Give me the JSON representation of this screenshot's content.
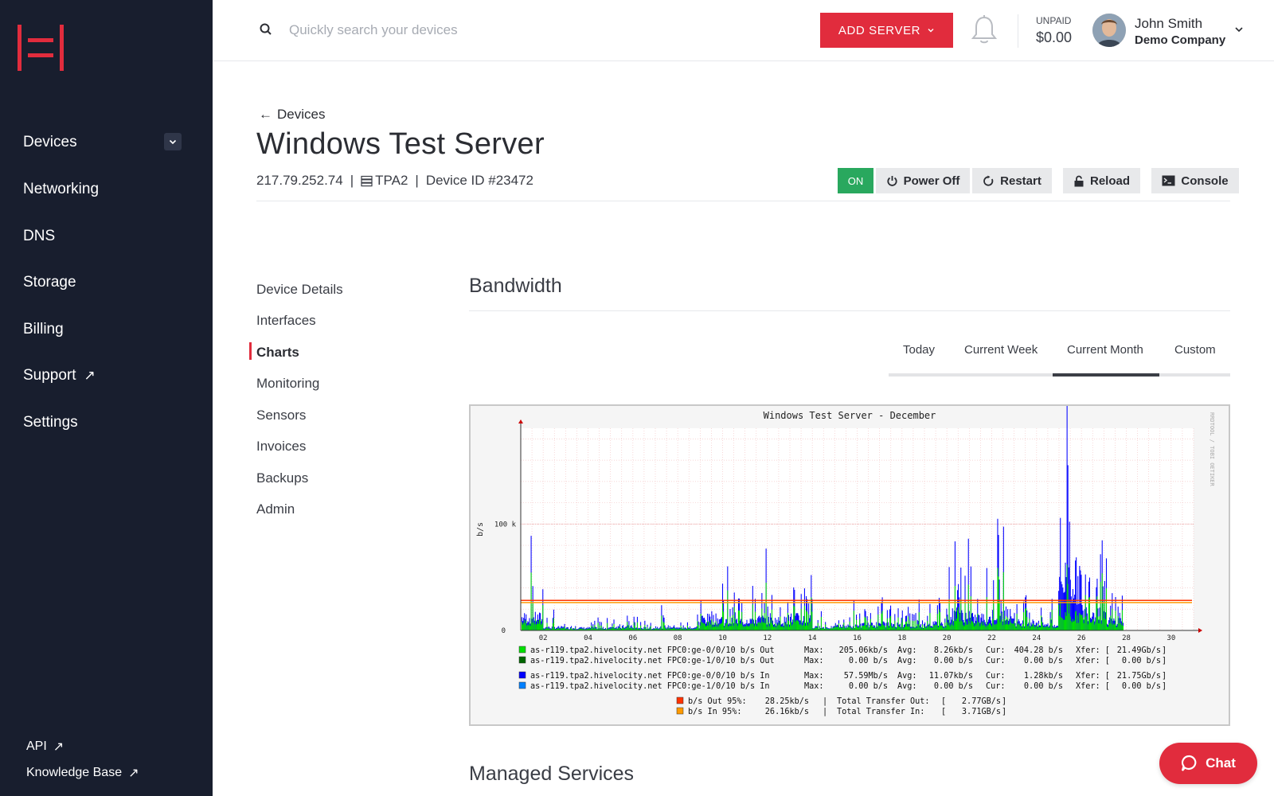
{
  "sidebar": {
    "logo_icon": "hivelocity-logo-icon",
    "items": [
      {
        "label": "Devices",
        "has_chevron": true
      },
      {
        "label": "Networking"
      },
      {
        "label": "DNS"
      },
      {
        "label": "Storage"
      },
      {
        "label": "Billing"
      },
      {
        "label": "Support",
        "external": true
      },
      {
        "label": "Settings"
      }
    ],
    "footer": [
      {
        "label": "API"
      },
      {
        "label": "Knowledge Base"
      }
    ]
  },
  "topbar": {
    "search_placeholder": "Quickly search your devices",
    "add_server_label": "ADD SERVER",
    "unpaid_label": "UNPAID",
    "unpaid_amount": "$0.00",
    "user_name": "John Smith",
    "user_company": "Demo Company"
  },
  "header": {
    "back_label": "Devices",
    "title": "Windows Test Server",
    "ip": "217.79.252.74",
    "location": "TPA2",
    "device_id": "Device ID #23472",
    "power_state": "ON",
    "actions": {
      "power_off": "Power Off",
      "restart": "Restart",
      "reload": "Reload",
      "console": "Console"
    }
  },
  "subnav": {
    "items": [
      "Device Details",
      "Interfaces",
      "Charts",
      "Monitoring",
      "Sensors",
      "Invoices",
      "Backups",
      "Admin"
    ],
    "active": "Charts"
  },
  "bandwidth": {
    "title": "Bandwidth",
    "tabs": [
      "Today",
      "Current Week",
      "Current Month",
      "Custom"
    ],
    "active_tab": "Current Month"
  },
  "managed_services_title": "Managed Services",
  "chat_label": "Chat",
  "colors": {
    "brand_red": "#e12c3d",
    "sidebar_bg": "#181e2e",
    "on_green": "#29a85e",
    "out_green": "#00e000",
    "out_dark_green": "#006600",
    "in_blue": "#0000ff",
    "in_light_blue": "#0080ff",
    "p95_out_red": "#ff3300",
    "p95_in_orange": "#ff9900"
  },
  "chart_data": {
    "type": "area",
    "title": "Windows Test Server - December",
    "ylabel": "b/s",
    "yticks": [
      "0",
      "100 k"
    ],
    "ylim": [
      0,
      190000
    ],
    "xticks": [
      "02",
      "04",
      "06",
      "08",
      "10",
      "12",
      "14",
      "16",
      "18",
      "20",
      "22",
      "24",
      "26",
      "28",
      "30"
    ],
    "watermark": "RRDTOOL / TOBI OETIKER",
    "x": [
      1,
      2,
      3,
      4,
      5,
      6,
      7,
      8,
      9,
      10,
      11,
      12,
      13,
      14,
      15,
      16,
      17,
      18,
      19,
      20,
      21,
      22,
      23,
      24,
      25,
      26,
      27,
      28
    ],
    "series": [
      {
        "name": "as-r119.tpa2.hivelocity.net FPC0:ge-0/0/10 b/s Out",
        "values": [
          22000,
          5000,
          4000,
          4000,
          6000,
          4000,
          6000,
          4000,
          18000,
          16000,
          18000,
          16000,
          20000,
          6000,
          8000,
          10000,
          10000,
          8000,
          12000,
          22000,
          18000,
          24000,
          14000,
          10000,
          38000,
          32000,
          16000,
          0
        ]
      },
      {
        "name": "as-r119.tpa2.hivelocity.net FPC0:ge-1/0/10 b/s Out",
        "values": [
          0,
          0,
          0,
          0,
          0,
          0,
          0,
          0,
          0,
          0,
          0,
          0,
          0,
          0,
          0,
          0,
          0,
          0,
          0,
          0,
          0,
          0,
          0,
          0,
          0,
          0,
          0,
          0
        ]
      },
      {
        "name": "as-r119.tpa2.hivelocity.net FPC0:ge-0/0/10 b/s In",
        "values": [
          42000,
          10000,
          8000,
          8000,
          12000,
          8000,
          12000,
          8000,
          38000,
          30000,
          36000,
          32000,
          40000,
          10000,
          14000,
          18000,
          20000,
          16000,
          22000,
          52000,
          40000,
          50000,
          26000,
          18000,
          165000,
          60000,
          32000,
          0
        ]
      },
      {
        "name": "as-r119.tpa2.hivelocity.net FPC0:ge-1/0/10 b/s In",
        "values": [
          0,
          0,
          0,
          0,
          0,
          0,
          0,
          0,
          0,
          0,
          0,
          0,
          0,
          0,
          0,
          0,
          0,
          0,
          0,
          0,
          0,
          0,
          0,
          0,
          0,
          0,
          0,
          0
        ]
      }
    ],
    "percentile_95": {
      "out": 28250,
      "in": 26160
    },
    "legend": [
      {
        "color": "#00e000",
        "label": "as-r119.tpa2.hivelocity.net FPC0:ge-0/0/10 b/s Out",
        "max": "205.06kb/s",
        "avg": "8.26kb/s",
        "cur": "404.28 b/s",
        "xfer": "21.49Gb/s"
      },
      {
        "color": "#006600",
        "label": "as-r119.tpa2.hivelocity.net FPC0:ge-1/0/10 b/s Out",
        "max": "0.00 b/s",
        "avg": "0.00 b/s",
        "cur": "0.00 b/s",
        "xfer": "0.00 b/s"
      },
      {
        "color": "#0000ff",
        "label": "as-r119.tpa2.hivelocity.net FPC0:ge-0/0/10 b/s In",
        "max": "57.59Mb/s",
        "avg": "11.07kb/s",
        "cur": "1.28kb/s",
        "xfer": "21.75Gb/s"
      },
      {
        "color": "#0080ff",
        "label": "as-r119.tpa2.hivelocity.net FPC0:ge-1/0/10 b/s In",
        "max": "0.00 b/s",
        "avg": "0.00 b/s",
        "cur": "0.00 b/s",
        "xfer": "0.00 b/s"
      }
    ],
    "summary": [
      {
        "color": "#ff3300",
        "label": "b/s Out 95%:",
        "value": "28.25kb/s",
        "total_label": "Total Transfer Out:",
        "total": "2.77GB/s"
      },
      {
        "color": "#ff9900",
        "label": "b/s In  95%:",
        "value": "26.16kb/s",
        "total_label": "Total Transfer In:",
        "total": "3.71GB/s"
      }
    ]
  }
}
